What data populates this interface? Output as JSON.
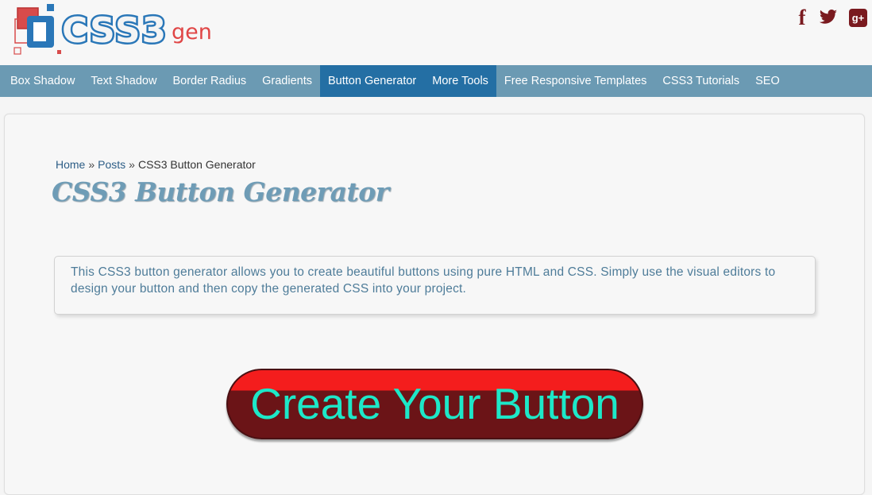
{
  "header": {
    "logo": {
      "text_main": "CSS3",
      "text_suffix": "gen"
    },
    "social": [
      {
        "name": "facebook-icon",
        "glyph": "f"
      },
      {
        "name": "twitter-icon",
        "glyph": ""
      },
      {
        "name": "google-plus-icon",
        "glyph": "g+"
      }
    ]
  },
  "nav": {
    "items": [
      {
        "label": "Box Shadow",
        "active": false
      },
      {
        "label": "Text Shadow",
        "active": false
      },
      {
        "label": "Border Radius",
        "active": false
      },
      {
        "label": "Gradients",
        "active": false
      },
      {
        "label": "Button Generator",
        "active": true
      },
      {
        "label": "More Tools",
        "active": false
      },
      {
        "label": "Free Responsive Templates",
        "active": false
      },
      {
        "label": "CSS3 Tutorials",
        "active": false
      },
      {
        "label": "SEO",
        "active": false
      }
    ]
  },
  "breadcrumb": {
    "home": "Home",
    "separator": "»",
    "posts": "Posts",
    "current": "CSS3 Button Generator"
  },
  "page": {
    "title": "CSS3 Button Generator",
    "intro": "This CSS3 button generator allows you to create beautiful buttons using pure HTML and CSS. Simply use the visual editors to design your button and then copy the generated CSS into your project."
  },
  "preview_button": {
    "label": "Create Your Button",
    "text_color": "#1de8c8",
    "top_color": "#f41d1d",
    "bottom_color": "#6b1417"
  },
  "colors": {
    "nav_bg": "#6b9ab3",
    "nav_active": "#246fa4",
    "logo_blue": "#2a77b8",
    "logo_red": "#d83a3a",
    "social": "#7a1a1f"
  }
}
